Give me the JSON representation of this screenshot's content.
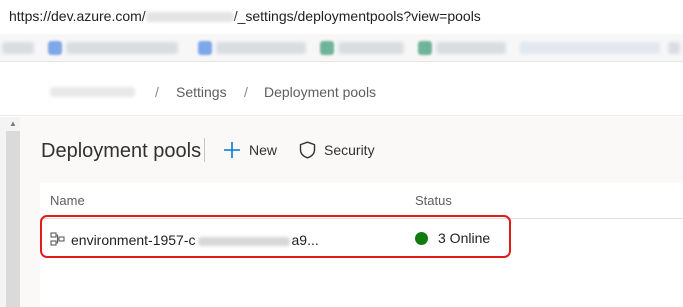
{
  "browser": {
    "url_prefix": "https://dev.azure.com/",
    "url_suffix": "/_settings/deploymentpools?view=pools"
  },
  "breadcrumb": {
    "items": [
      "Settings",
      "Deployment pools"
    ],
    "separator": "/"
  },
  "toolbar": {
    "title": "Deployment pools",
    "new_label": "New",
    "security_label": "Security"
  },
  "table": {
    "columns": [
      "Name",
      "Status"
    ],
    "rows": [
      {
        "name_prefix": "environment-1957-c",
        "name_suffix": "a9...",
        "status": "3 Online",
        "status_color": "#107c10"
      }
    ]
  },
  "colors": {
    "accent": "#0078d4",
    "highlight_border": "#e11a1a"
  },
  "icons": {
    "new": "plus-icon",
    "security": "shield-icon",
    "pool": "deployment-pool-icon",
    "status": "online-dot-icon"
  }
}
